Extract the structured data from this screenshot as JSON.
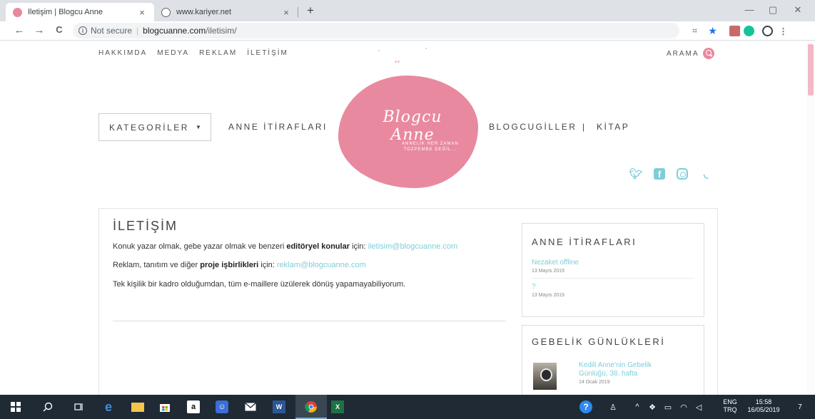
{
  "browser": {
    "tabs": [
      {
        "title": "İletişim | Blogcu Anne",
        "active": true
      },
      {
        "title": "www.kariyer.net",
        "active": false
      }
    ],
    "new_tab": "+",
    "tab_close": "×",
    "window_controls": {
      "minimize": "—",
      "restore": "▢",
      "close": "✕"
    },
    "nav": {
      "back": "←",
      "forward": "→",
      "reload": "C"
    },
    "address": {
      "security": "Not secure",
      "host": "blogcuanne.com",
      "path": "/iletisim/"
    },
    "menu": "⋮"
  },
  "site": {
    "top_nav": [
      "HAKKIMDA",
      "MEDYA",
      "REKLAM",
      "İLETİŞİM"
    ],
    "search_label": "ARAMA",
    "logo": {
      "script": "Blogcu Anne",
      "tagline_1": "ANNELİK HER ZAMAN",
      "tagline_2": "TOZPEMBE DEĞİL..."
    },
    "categories_label": "KATEGORİLER",
    "main_nav": {
      "item1": "ANNE İTİRAFLARI",
      "item2": "BLOGCUGİLLER",
      "sep": "|",
      "item3": "KİTAP"
    },
    "social": [
      "twitter-icon",
      "facebook-icon",
      "instagram-icon",
      "rss-icon"
    ]
  },
  "content": {
    "title": "İLETİŞİM",
    "line1": {
      "before": "Konuk yazar olmak, gebe yazar olmak ve benzeri ",
      "bold": "editöryel konular",
      "after": " için: ",
      "email": "iletisim@blogcuanne.com"
    },
    "line2": {
      "before": "Reklam, tanıtım ve diğer ",
      "bold": "proje işbirlikleri",
      "after": " için: ",
      "email": "reklam@blogcuanne.com"
    },
    "line3": "Tek kişilik bir kadro olduğumdan, tüm e-maillere üzülerek dönüş yapamayabiliyorum."
  },
  "sidebar": {
    "widget1": {
      "title": "ANNE İTİRAFLARI",
      "posts": [
        {
          "title": "Nezaket offline",
          "date": "13 Mayıs 2019"
        },
        {
          "title": "?",
          "date": "13 Mayıs 2019"
        }
      ]
    },
    "widget2": {
      "title": "GEBELİK GÜNLÜKLERİ",
      "posts": [
        {
          "title_1": "Kedili Anne'nin Gebelik",
          "title_2": "Günlüğü, 38. hafta",
          "date": "14 Ocak 2019"
        }
      ]
    }
  },
  "taskbar": {
    "lang_1": "ENG",
    "lang_2": "TRQ",
    "time": "15:58",
    "date": "16/05/2019",
    "notifications": "7",
    "colors": {
      "background": "#1f2a35",
      "accent": "#e8899f",
      "link": "#7fcdd9"
    }
  }
}
